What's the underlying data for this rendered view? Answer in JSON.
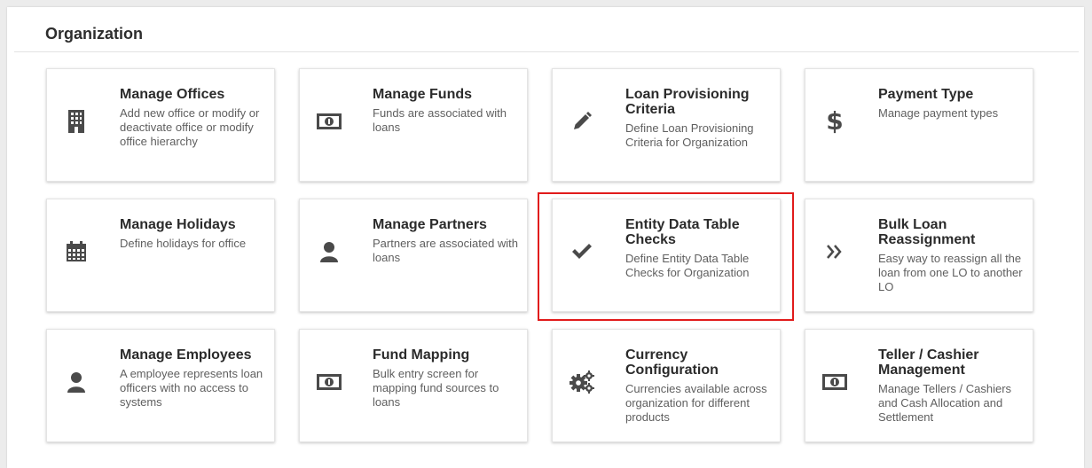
{
  "section": {
    "title": "Organization"
  },
  "colors": {
    "icon": "#4a4a4a",
    "highlight": "#e11b1b"
  },
  "cards": [
    {
      "title": "Manage Offices",
      "desc": "Add new office or modify or deactivate office or modify office hierarchy",
      "icon": "building-icon"
    },
    {
      "title": "Manage Funds",
      "desc": "Funds are associated with loans",
      "icon": "money-icon"
    },
    {
      "title": "Loan Provisioning Criteria",
      "desc": "Define Loan Provisioning Criteria for Organization",
      "icon": "pencil-icon"
    },
    {
      "title": "Payment Type",
      "desc": "Manage payment types",
      "icon": "dollar-icon"
    },
    {
      "title": "Manage Holidays",
      "desc": "Define holidays for office",
      "icon": "calendar-icon"
    },
    {
      "title": "Manage Partners",
      "desc": "Partners are associated with loans",
      "icon": "user-icon"
    },
    {
      "title": "Entity Data Table Checks",
      "desc": "Define Entity Data Table Checks for Organization",
      "icon": "check-icon"
    },
    {
      "title": "Bulk Loan Reassignment",
      "desc": "Easy way to reassign all the loan from one LO to another LO",
      "icon": "double-chevron-icon"
    },
    {
      "title": "Manage Employees",
      "desc": "A employee represents loan officers with no access to systems",
      "icon": "user-icon"
    },
    {
      "title": "Fund Mapping",
      "desc": "Bulk entry screen for mapping fund sources to loans",
      "icon": "money-icon"
    },
    {
      "title": "Currency Configuration",
      "desc": "Currencies available across organization for different products",
      "icon": "gears-icon"
    },
    {
      "title": "Teller / Cashier Management",
      "desc": "Manage Tellers / Cashiers and Cash Allocation and Settlement",
      "icon": "money-icon"
    }
  ]
}
